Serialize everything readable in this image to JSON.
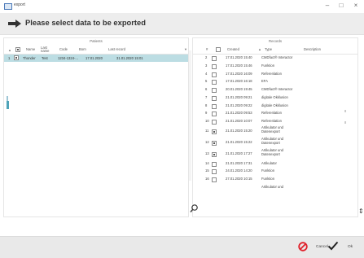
{
  "window": {
    "title": "export",
    "minimize": "–",
    "maximize": "□",
    "close": "×"
  },
  "header": {
    "text": "Please select data to be exported"
  },
  "patients": {
    "title": "Patients",
    "columns": [
      "Name",
      "Last name",
      "Code",
      "Born",
      "Last record"
    ],
    "rows": [
      {
        "index": "1",
        "name": "Thonder",
        "last_name": "Test",
        "code": "1234-1324-...",
        "born": "17.01.2020",
        "last_record": "31.01.2020 15:01"
      }
    ]
  },
  "records": {
    "title": "Records",
    "columns": [
      "#",
      "Created",
      "Type",
      "Description"
    ],
    "rows": [
      {
        "n": "2",
        "created": "17.01.2020 15:40",
        "type": "CMDfact® Interactor",
        "checked": false
      },
      {
        "n": "3",
        "created": "17.01.2020 15:46",
        "type": "Funktion",
        "checked": false
      },
      {
        "n": "4",
        "created": "17.01.2020 16:09",
        "type": "Referenlation",
        "checked": false
      },
      {
        "n": "5",
        "created": "17.01.2020 16:18",
        "type": "EFA",
        "checked": false
      },
      {
        "n": "6",
        "created": "20.01.2020 19:45",
        "type": "CMDfact® Interactor",
        "checked": false
      },
      {
        "n": "7",
        "created": "21.01.2020 09:21",
        "type": "digitale Okklusion",
        "checked": false
      },
      {
        "n": "8",
        "created": "21.01.2020 09:22",
        "type": "digitale Okklusion",
        "checked": false
      },
      {
        "n": "9",
        "created": "21.01.2020 09:53",
        "type": "Referenlation",
        "checked": false
      },
      {
        "n": "10",
        "created": "21.01.2020 10:07",
        "type": "Referenlation",
        "checked": false
      },
      {
        "n": "11",
        "created": "21.01.2020 15:20",
        "type": "Artikulator und Datenexport",
        "checked": true
      },
      {
        "n": "12",
        "created": "21.01.2020 15:22",
        "type": "Artikulator und Datenexport",
        "checked": true
      },
      {
        "n": "13",
        "created": "21.01.2020 17:27",
        "type": "Artikulator und Datenexport",
        "checked": true
      },
      {
        "n": "14",
        "created": "21.01.2020 17:31",
        "type": "Artikulator",
        "checked": false
      },
      {
        "n": "15",
        "created": "24.01.2020 14:20",
        "type": "Funktion",
        "checked": false
      },
      {
        "n": "16",
        "created": "27.01.2020 10:15",
        "type": "Funktion",
        "checked": false
      },
      {
        "n": "",
        "created": "",
        "type": "Artikulator und",
        "checked": false
      }
    ]
  },
  "footer": {
    "cancel_label": "Cancel",
    "ok_label": "Ok"
  },
  "colors": {
    "selected_row": "#bcdde3",
    "cancel_red": "#e0202a",
    "header_bg": "#ededed"
  },
  "icons": [
    "arrow-right-icon",
    "search-icon",
    "cancel-icon",
    "checkmark-icon"
  ]
}
